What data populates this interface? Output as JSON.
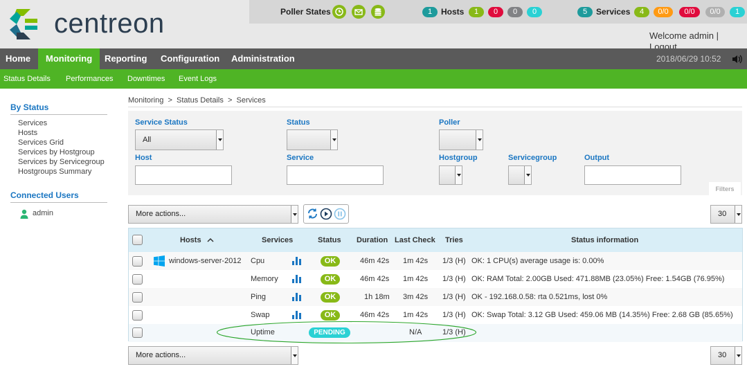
{
  "brand": {
    "name": "centreon"
  },
  "header": {
    "poller_states_label": "Poller States",
    "poller_icons": [
      "database-icon",
      "clock-icon",
      "mail-icon"
    ],
    "hosts": {
      "count": "1",
      "label": "Hosts",
      "up": "1",
      "down": "0",
      "unreachable": "0",
      "pending": "0"
    },
    "services": {
      "count": "5",
      "label": "Services",
      "ok": "4",
      "warning": "0/0",
      "critical": "0/0",
      "unknown": "0/0",
      "pending": "1"
    },
    "welcome": "Welcome admin | Logout",
    "datetime": "2018/06/29 10:52"
  },
  "colors": {
    "green": "#88b917",
    "red": "#e00b3d",
    "grey": "#818285",
    "cyan": "#2ad1d4",
    "orange": "#ff9a13",
    "teal": "#1e9b9c",
    "menu": "#5a5a5a",
    "submenu": "#4fb425"
  },
  "menu": {
    "items": [
      "Home",
      "Monitoring",
      "Reporting",
      "Configuration",
      "Administration"
    ],
    "active": "Monitoring"
  },
  "submenu": {
    "items": [
      "Status  Details",
      "Performances",
      "Downtimes",
      "Event  Logs"
    ]
  },
  "sidebar": {
    "by_status": "By Status",
    "links": [
      "Services",
      "Hosts",
      "Services Grid",
      "Services by Hostgroup",
      "Services by Servicegroup",
      "Hostgroups Summary"
    ],
    "connected_users": "Connected Users",
    "users": [
      "admin"
    ]
  },
  "breadcrumb": "Monitoring  >  Status Details  >  Services",
  "filters": {
    "service_status_label": "Service Status",
    "service_status_value": "All",
    "status_label": "Status",
    "status_value": "",
    "poller_label": "Poller",
    "poller_value": "",
    "host_label": "Host",
    "host_value": "",
    "service_label": "Service",
    "service_value": "",
    "hostgroup_label": "Hostgroup",
    "servicegroup_label": "Servicegroup",
    "output_label": "Output",
    "output_value": "",
    "filters_link": "Filters"
  },
  "toolbar": {
    "more_actions": "More actions...",
    "per_page": "30"
  },
  "table": {
    "headers": {
      "hosts": "Hosts",
      "services": "Services",
      "status": "Status",
      "duration": "Duration",
      "last_check": "Last Check",
      "tries": "Tries",
      "info": "Status information"
    },
    "rows": [
      {
        "host": "windows-server-2012",
        "service": "Cpu",
        "status": "OK",
        "duration": "46m 42s",
        "last_check": "1m 42s",
        "tries": "1/3 (H)",
        "info": "OK: 1 CPU(s) average usage is: 0.00%"
      },
      {
        "host": "",
        "service": "Memory",
        "status": "OK",
        "duration": "46m 42s",
        "last_check": "1m 42s",
        "tries": "1/3 (H)",
        "info": "OK: RAM Total: 2.00GB Used: 471.88MB (23.05%) Free: 1.54GB (76.95%)"
      },
      {
        "host": "",
        "service": "Ping",
        "status": "OK",
        "duration": "1h 18m",
        "last_check": "3m 42s",
        "tries": "1/3 (H)",
        "info": "OK - 192.168.0.58: rta 0.521ms, lost 0%"
      },
      {
        "host": "",
        "service": "Swap",
        "status": "OK",
        "duration": "46m 42s",
        "last_check": "1m 42s",
        "tries": "1/3 (H)",
        "info": "OK: Swap Total: 3.12 GB Used: 459.06 MB (14.35%) Free: 2.68 GB (85.65%)"
      },
      {
        "host": "",
        "service": "Uptime",
        "status": "PENDING",
        "duration": "",
        "last_check": "N/A",
        "tries": "1/3 (H)",
        "info": ""
      }
    ]
  }
}
